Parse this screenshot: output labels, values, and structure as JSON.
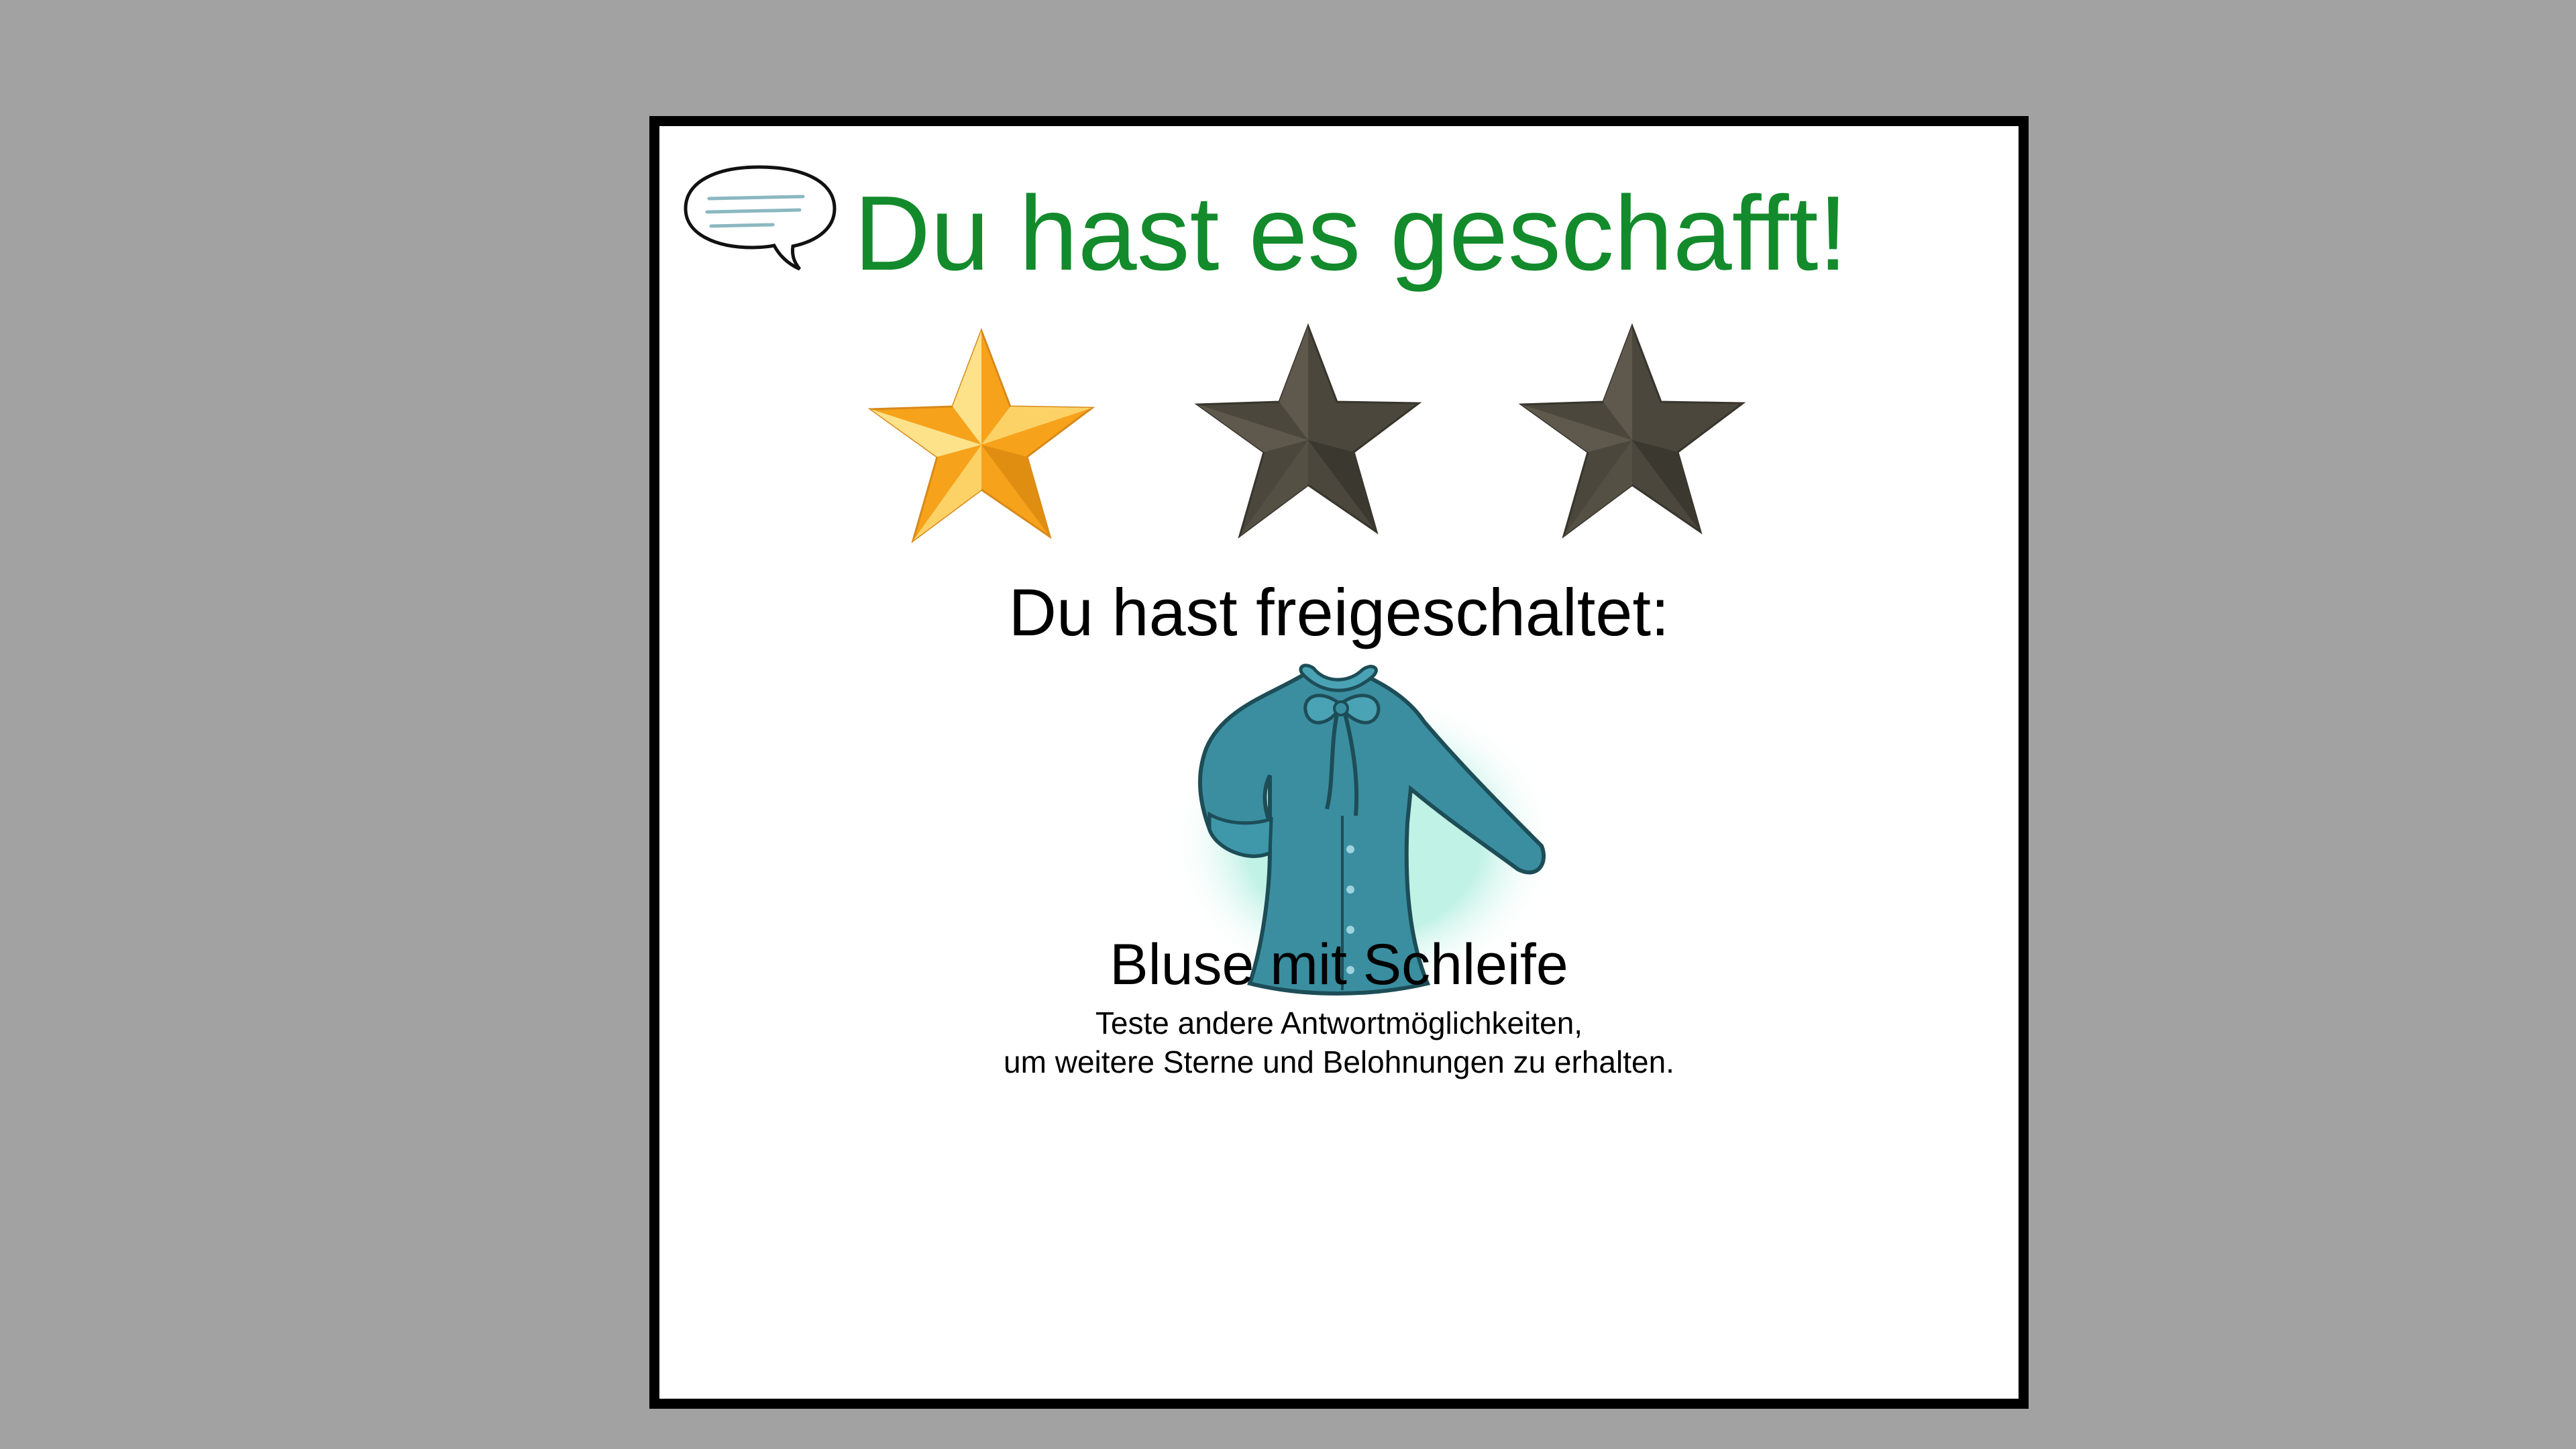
{
  "dialog": {
    "title": "Du hast es geschafft!",
    "title_color": "#138a2b",
    "speech_icon": "speech-bubble-icon"
  },
  "rating": {
    "earned_stars": 1,
    "total_stars": 3,
    "earned_color": "#f7a21b",
    "unearned_color": "#4b473c"
  },
  "unlock": {
    "heading": "Du hast freigeschaltet:",
    "item_icon": "blouse-icon",
    "item_name": "Bluse mit Schleife",
    "hint_line1": "Teste andere Antwortmöglichkeiten,",
    "hint_line2": "um weitere Sterne und Belohnungen zu erhalten."
  }
}
